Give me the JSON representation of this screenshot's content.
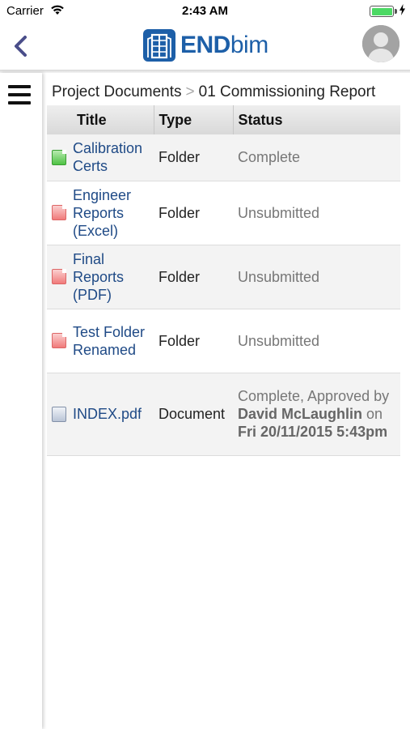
{
  "statusbar": {
    "carrier": "Carrier",
    "time": "2:43 AM",
    "battery_level": 1.0
  },
  "header": {
    "logo_text_bold": "END",
    "logo_text_light": "bim",
    "brand_color": "#1d5fa8"
  },
  "breadcrumb": {
    "root": "Project Documents",
    "separator": ">",
    "current": "01 Commissioning Report"
  },
  "table": {
    "columns": [
      "Title",
      "Type",
      "Status"
    ],
    "rows": [
      {
        "title": "Calibration Certs",
        "type": "Folder",
        "status": "Complete",
        "icon": "green-folder-icon"
      },
      {
        "title": "Engineer Reports (Excel)",
        "type": "Folder",
        "status": "Unsubmitted",
        "icon": "red-folder-icon"
      },
      {
        "title": "Final Reports (PDF)",
        "type": "Folder",
        "status": "Unsubmitted",
        "icon": "red-folder-icon"
      },
      {
        "title": "Test Folder Renamed",
        "type": "Folder",
        "status": "Unsubmitted",
        "icon": "red-folder-icon"
      },
      {
        "title": "INDEX.pdf",
        "type": "Document",
        "status_prefix": "Complete, Approved by",
        "status_user": "David McLaughlin",
        "status_on": "on",
        "status_date": "Fri 20/11/2015 5:43pm",
        "icon": "document-icon"
      }
    ]
  }
}
